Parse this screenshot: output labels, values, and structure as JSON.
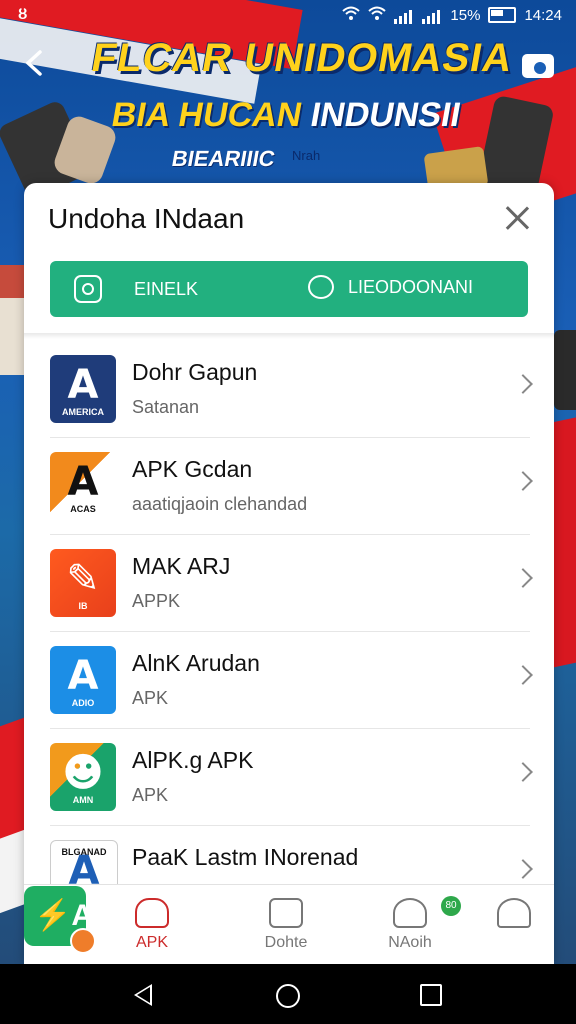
{
  "status_bar": {
    "carrier_glyph": "ȣ",
    "battery_pct": "15%",
    "time": "14:24"
  },
  "banner": {
    "line1": "FLCAR UNIDOMASIA",
    "line2_yellow": "BIA HUCAN",
    "line2_white": "INDUNSII",
    "line3": "BIEARIIIC",
    "line3_small": "Nrah"
  },
  "sheet": {
    "title": "Undoha INdaan",
    "actions": [
      {
        "icon": "instagram-icon",
        "label": "EINELK"
      },
      {
        "icon": "chat-icon",
        "label": "LIEODOONANI"
      }
    ],
    "apps": [
      {
        "name": "Dohr Gapun",
        "subtitle": "Satanan",
        "icon_text": "A",
        "mini": "AMERICA"
      },
      {
        "name": "APK Gcdan",
        "subtitle": "aaatiqjaoin clehandad",
        "icon_text": "A",
        "mini": "ACAS"
      },
      {
        "name": "MAK ARJ",
        "subtitle": "APPK",
        "icon_text": "✎",
        "mini": "IB"
      },
      {
        "name": "AlnK Arudan",
        "subtitle": "APK",
        "icon_text": "A",
        "mini": "ADIO"
      },
      {
        "name": "AlPK.g APK",
        "subtitle": "APK",
        "icon_text": "☻",
        "mini": "AMN"
      },
      {
        "name": "PaaK Lastm INorenad",
        "subtitle": "",
        "icon_text": "A",
        "mini": "BLGANAD"
      }
    ]
  },
  "tabbar": {
    "fab_glyph": "⚡A",
    "tabs": [
      {
        "label": "APK",
        "icon": "heart-icon",
        "active": true
      },
      {
        "label": "Dohte",
        "icon": "chat-bubble-icon",
        "active": false
      },
      {
        "label": "NAoih",
        "icon": "people-icon",
        "active": false,
        "badge": "80"
      },
      {
        "label": "",
        "icon": "profile-icon",
        "active": false
      }
    ]
  },
  "colors": {
    "accent_green": "#22b07f",
    "flag_red": "#e01b22",
    "banner_yellow": "#ffd21c"
  }
}
